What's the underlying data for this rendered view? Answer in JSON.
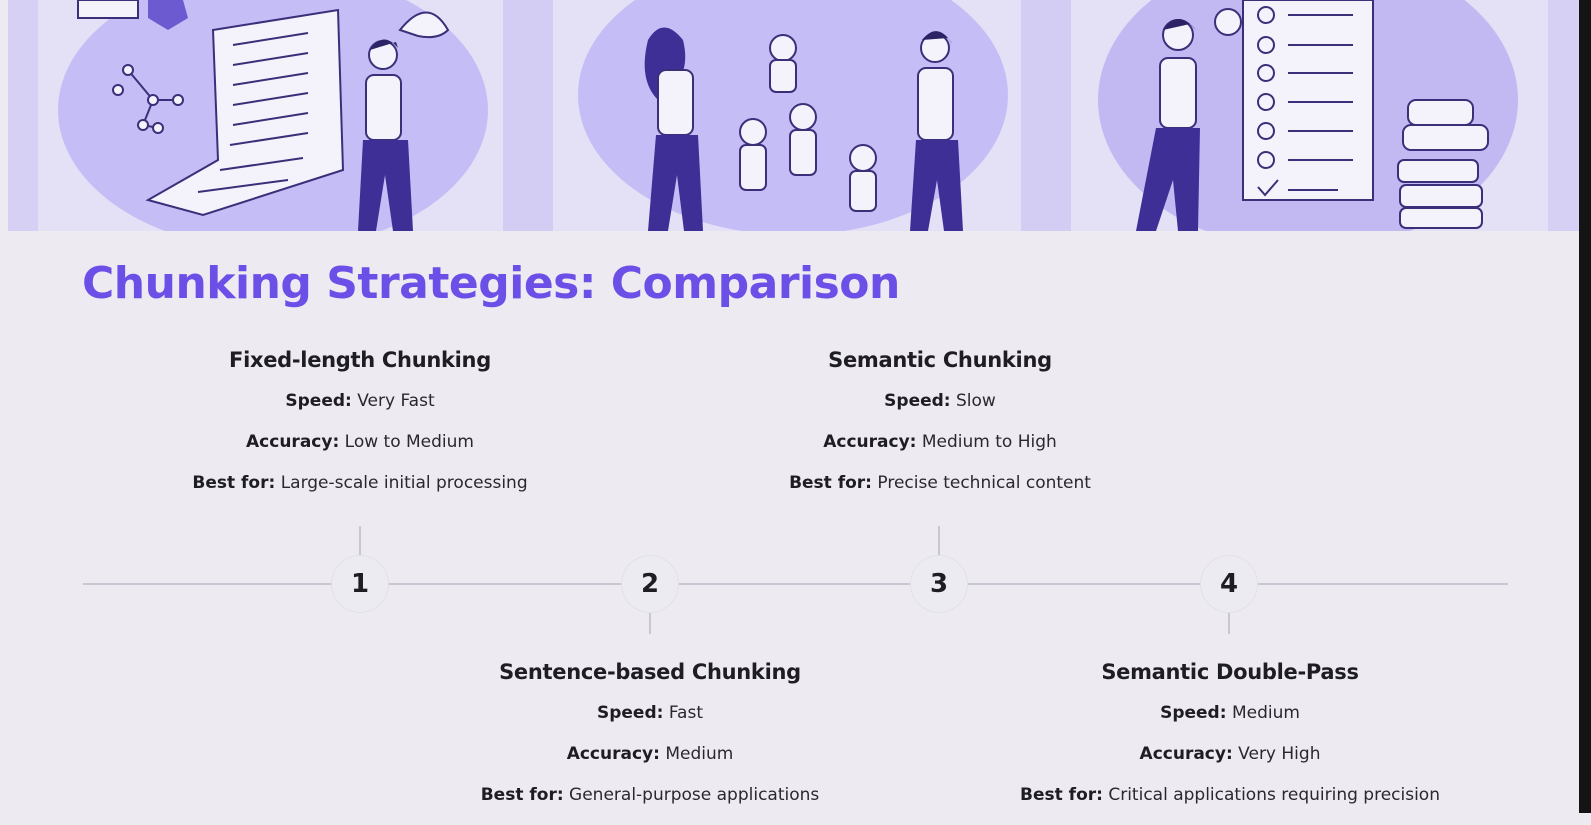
{
  "title": "Chunking Strategies: Comparison",
  "colors": {
    "accent": "#6c4fe6",
    "banner_bg": "#e4e0f6",
    "illustration": "#8b79e8"
  },
  "steps": [
    {
      "number": "1",
      "title": "Fixed-length Chunking",
      "speed_label": "Speed:",
      "speed": "Very Fast",
      "accuracy_label": "Accuracy:",
      "accuracy": "Low to Medium",
      "best_label": "Best for:",
      "best": "Large-scale initial processing"
    },
    {
      "number": "2",
      "title": "Sentence-based Chunking",
      "speed_label": "Speed:",
      "speed": "Fast",
      "accuracy_label": "Accuracy:",
      "accuracy": "Medium",
      "best_label": "Best for:",
      "best": "General-purpose applications"
    },
    {
      "number": "3",
      "title": "Semantic Chunking",
      "speed_label": "Speed:",
      "speed": "Slow",
      "accuracy_label": "Accuracy:",
      "accuracy": "Medium to High",
      "best_label": "Best for:",
      "best": "Precise technical content"
    },
    {
      "number": "4",
      "title": "Semantic Double-Pass",
      "speed_label": "Speed:",
      "speed": "Medium",
      "accuracy_label": "Accuracy:",
      "accuracy": "Very High",
      "best_label": "Best for:",
      "best": "Critical applications requiring precision"
    }
  ]
}
